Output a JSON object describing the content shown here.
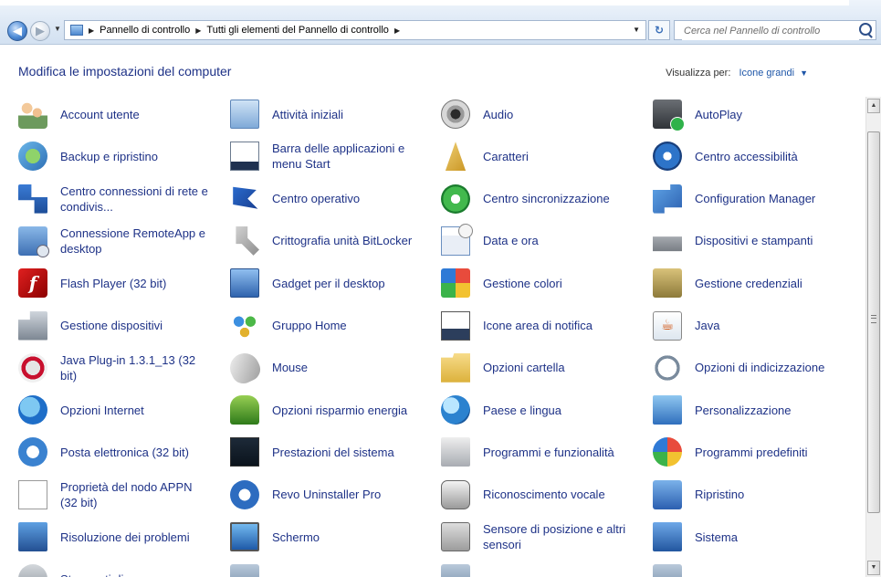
{
  "nav": {
    "back_glyph": "◀",
    "forward_glyph": "▶",
    "breadcrumbs": [
      "Pannello di controllo",
      "Tutti gli elementi del Pannello di controllo"
    ],
    "refresh_glyph": "↻",
    "search_placeholder": "Cerca nel Pannello di controllo"
  },
  "header": {
    "title": "Modifica le impostazioni del computer",
    "view_by_label": "Visualizza per:",
    "view_by_value": "Icone grandi"
  },
  "items": [
    {
      "label": "Account utente",
      "icon": "user-accounts-icon",
      "style": "i-users"
    },
    {
      "label": "Attività iniziali",
      "icon": "getting-started-icon",
      "style": "i-window"
    },
    {
      "label": "Audio",
      "icon": "audio-icon",
      "style": "i-audio"
    },
    {
      "label": "AutoPlay",
      "icon": "autoplay-icon",
      "style": "i-autoplay"
    },
    {
      "label": "Backup e ripristino",
      "icon": "backup-restore-icon",
      "style": "i-backup"
    },
    {
      "label": "Barra delle applicazioni e menu Start",
      "icon": "taskbar-start-menu-icon",
      "style": "i-taskbar"
    },
    {
      "label": "Caratteri",
      "icon": "fonts-icon",
      "style": "i-fonts"
    },
    {
      "label": "Centro accessibilità",
      "icon": "ease-of-access-icon",
      "style": "i-access"
    },
    {
      "label": "Centro connessioni di rete e condivis...",
      "icon": "network-sharing-icon",
      "style": "i-network"
    },
    {
      "label": "Centro operativo",
      "icon": "action-center-icon",
      "style": "i-flag"
    },
    {
      "label": "Centro sincronizzazione",
      "icon": "sync-center-icon",
      "style": "i-sync"
    },
    {
      "label": "Configuration Manager",
      "icon": "configuration-manager-icon",
      "style": "i-config"
    },
    {
      "label": "Connessione RemoteApp e desktop",
      "icon": "remoteapp-icon",
      "style": "i-remote"
    },
    {
      "label": "Crittografia unità BitLocker",
      "icon": "bitlocker-icon",
      "style": "i-keys"
    },
    {
      "label": "Data e ora",
      "icon": "date-time-icon",
      "style": "i-calendar"
    },
    {
      "label": "Dispositivi e stampanti",
      "icon": "devices-printers-icon",
      "style": "i-printer"
    },
    {
      "label": "Flash Player (32 bit)",
      "icon": "flash-player-icon",
      "style": "i-flash",
      "glyph": "f"
    },
    {
      "label": "Gadget per il desktop",
      "icon": "desktop-gadgets-icon",
      "style": "i-gadget"
    },
    {
      "label": "Gestione colori",
      "icon": "color-management-icon",
      "style": "i-colors"
    },
    {
      "label": "Gestione credenziali",
      "icon": "credential-manager-icon",
      "style": "i-vault"
    },
    {
      "label": "Gestione dispositivi",
      "icon": "device-manager-icon",
      "style": "i-devmgr"
    },
    {
      "label": "Gruppo Home",
      "icon": "homegroup-icon",
      "style": "i-home"
    },
    {
      "label": "Icone area di notifica",
      "icon": "notification-area-icon",
      "style": "i-notify"
    },
    {
      "label": "Java",
      "icon": "java-icon",
      "style": "i-java",
      "glyph": "☕"
    },
    {
      "label": "Java Plug-in 1.3.1_13 (32 bit)",
      "icon": "java-plugin-icon",
      "style": "i-javaplug"
    },
    {
      "label": "Mouse",
      "icon": "mouse-icon",
      "style": "i-mouse"
    },
    {
      "label": "Opzioni cartella",
      "icon": "folder-options-icon",
      "style": "i-folder"
    },
    {
      "label": "Opzioni di indicizzazione",
      "icon": "indexing-options-icon",
      "style": "i-index"
    },
    {
      "label": "Opzioni Internet",
      "icon": "internet-options-icon",
      "style": "i-ie"
    },
    {
      "label": "Opzioni risparmio energia",
      "icon": "power-options-icon",
      "style": "i-power"
    },
    {
      "label": "Paese e lingua",
      "icon": "region-language-icon",
      "style": "i-globe"
    },
    {
      "label": "Personalizzazione",
      "icon": "personalization-icon",
      "style": "i-paint"
    },
    {
      "label": "Posta elettronica (32 bit)",
      "icon": "mail-icon",
      "style": "i-mail"
    },
    {
      "label": "Prestazioni del sistema",
      "icon": "performance-icon",
      "style": "i-perf"
    },
    {
      "label": "Programmi e funzionalità",
      "icon": "programs-features-icon",
      "style": "i-programs"
    },
    {
      "label": "Programmi predefiniti",
      "icon": "default-programs-icon",
      "style": "i-defaults"
    },
    {
      "label": "Proprietà del nodo APPN (32 bit)",
      "icon": "appn-node-icon",
      "style": "i-doc"
    },
    {
      "label": "Revo Uninstaller Pro",
      "icon": "revo-uninstaller-icon",
      "style": "i-revo"
    },
    {
      "label": "Riconoscimento vocale",
      "icon": "microphone-icon",
      "style": "i-mic"
    },
    {
      "label": "Ripristino",
      "icon": "recovery-icon",
      "style": "i-restore"
    },
    {
      "label": "Risoluzione dei problemi",
      "icon": "troubleshooting-icon",
      "style": "i-trouble"
    },
    {
      "label": "Schermo",
      "icon": "display-icon",
      "style": "i-screen"
    },
    {
      "label": "Sensore di posizione e altri sensori",
      "icon": "location-sensors-icon",
      "style": "i-sensor"
    },
    {
      "label": "Sistema",
      "icon": "system-icon",
      "style": "i-system"
    },
    {
      "label": "Strumenti di",
      "icon": "admin-tools-icon",
      "style": "i-tools"
    },
    {
      "label": "",
      "icon": "generic-item-icon",
      "style": "i-generic"
    },
    {
      "label": "",
      "icon": "generic-item-icon",
      "style": "i-generic"
    },
    {
      "label": "",
      "icon": "generic-item-icon",
      "style": "i-generic"
    }
  ]
}
